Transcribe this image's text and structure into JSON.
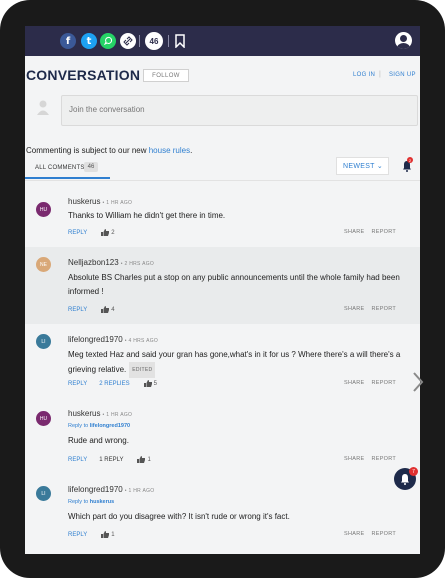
{
  "share_bar": {
    "icons": [
      "facebook-icon",
      "twitter-icon",
      "whatsapp-icon",
      "link-icon",
      "bookmark-icon",
      "account-icon"
    ],
    "comment_count": "46"
  },
  "header": {
    "title": "CONVERSATION",
    "follow_label": "FOLLOW",
    "login_label": "LOG IN",
    "separator": "|",
    "signup_label": "SIGN UP"
  },
  "composer": {
    "placeholder": "Join the conversation"
  },
  "rules": {
    "prefix": "Commenting is subject to our new ",
    "link_text": "house rules",
    "suffix": "."
  },
  "tabs": {
    "all_comments_label": "ALL COMMENTS",
    "all_comments_count": "46",
    "sort_label": "NEWEST",
    "notification_count": "2"
  },
  "colors": {
    "accent": "#2f7fd0",
    "navy": "#1e2a4a",
    "badge_red": "#e03030"
  },
  "comments": [
    {
      "initials": "HU",
      "user": "huskerus",
      "time": "• 1 HR AGO",
      "reply_to": "",
      "text": "Thanks to William he didn't get there in time.",
      "reply_label": "REPLY",
      "likes": "2",
      "replies": "",
      "share_label": "SHARE",
      "report_label": "REPORT"
    },
    {
      "initials": "NE",
      "user": "Nelljazbon123",
      "time": "• 2 HRS AGO",
      "reply_to": "",
      "text": "Absolute BS Charles put a stop on any public announcements until the whole family had been informed !",
      "reply_label": "REPLY",
      "likes": "4",
      "replies": "",
      "share_label": "SHARE",
      "report_label": "REPORT"
    },
    {
      "initials": "LI",
      "user": "lifelongred1970",
      "time": "• 4 HRS AGO",
      "reply_to": "",
      "text": "Meg texted Haz and said your gran has gone,what's in it for us ? Where there's a will there's a grieving relative.",
      "edited_label": "EDITED",
      "reply_label": "REPLY",
      "likes": "5",
      "replies": "2 REPLIES",
      "share_label": "SHARE",
      "report_label": "REPORT"
    },
    {
      "initials": "HU",
      "user": "huskerus",
      "time": "• 1 HR AGO",
      "reply_prefix": "Reply to",
      "reply_to": "lifelongred1970",
      "text": "Rude and wrong.",
      "reply_label": "REPLY",
      "likes": "1",
      "replies": "1 REPLY",
      "share_label": "SHARE",
      "report_label": "REPORT"
    },
    {
      "initials": "LI",
      "user": "lifelongred1970",
      "time": "• 1 HR AGO",
      "reply_prefix": "Reply to",
      "reply_to": "huskerus",
      "text": "Which part do you disagree with? It isn't rude or wrong it's fact.",
      "reply_label": "REPLY",
      "likes": "1",
      "replies": "",
      "share_label": "SHARE",
      "report_label": "REPORT"
    }
  ],
  "fab": {
    "badge_count": "7"
  }
}
